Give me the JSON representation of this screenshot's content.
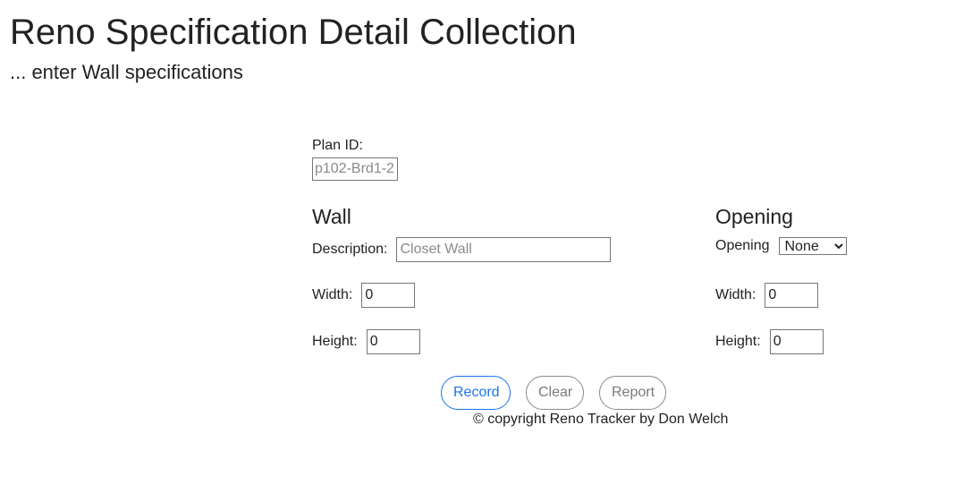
{
  "header": {
    "title": "Reno Specification Detail Collection",
    "subtitle": "... enter Wall specifications"
  },
  "plan": {
    "label": "Plan ID:",
    "placeholder": "p102-Brd1-2"
  },
  "wall": {
    "heading": "Wall",
    "description_label": "Description:",
    "description_placeholder": "Closet Wall",
    "width_label": "Width:",
    "width_value": "0",
    "height_label": "Height:",
    "height_value": "0"
  },
  "opening": {
    "heading": "Opening",
    "opening_label": "Opening",
    "opening_selected": "None",
    "width_label": "Width:",
    "width_value": "0",
    "height_label": "Height:",
    "height_value": "0"
  },
  "actions": {
    "record_label": "Record",
    "clear_label": "Clear",
    "report_label": "Report"
  },
  "footer": {
    "copyright": "© copyright Reno Tracker by Don Welch"
  },
  "colors": {
    "accent": "#1a73e8",
    "text": "#222222",
    "muted_button": "#7a7a7a"
  }
}
